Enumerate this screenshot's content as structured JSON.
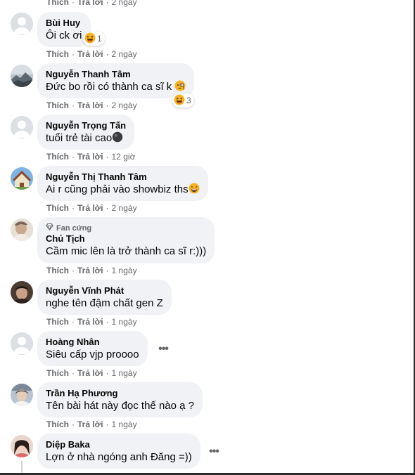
{
  "actions": {
    "like": "Thích",
    "reply": "Trả lời"
  },
  "top_partial": {
    "time": "2 ngày"
  },
  "comments": [
    {
      "name": "Bùi Huy",
      "text": "Ôi ck ơi",
      "reaction_count": "1",
      "time": "2 ngày"
    },
    {
      "name": "Nguyễn Thanh Tâm",
      "text": "Đức bo rồi có thành ca sĩ k",
      "reaction_count": "3",
      "time": "2 ngày"
    },
    {
      "name": "Nguyễn Trọng Tấn",
      "text": "tuổi trẻ tài cao",
      "time": "12 giờ"
    },
    {
      "name": "Nguyễn Thị Thanh Tâm",
      "text": "Ai r cũng phải vào showbiz ths",
      "time": "2 ngày"
    },
    {
      "badge": "Fan cứng",
      "name": "Chủ Tịch",
      "text": "Cầm mic lên là trở thành ca sĩ r:)))",
      "time": "1 ngày"
    },
    {
      "name": "Nguyễn Vĩnh Phát",
      "text": "nghe tên đậm chất gen Z",
      "time": "1 ngày"
    },
    {
      "name": "Hoàng Nhân",
      "text": "Siêu cấp vjp proooo",
      "time": "1 ngày"
    },
    {
      "name": "Trần Hạ Phương",
      "text": "Tên bài hát này đọc thế nào ạ ?",
      "time": "1 ngày"
    },
    {
      "name": "Diệp Baka",
      "text": "Lợn ở nhà ngóng anh Đăng =))"
    }
  ]
}
